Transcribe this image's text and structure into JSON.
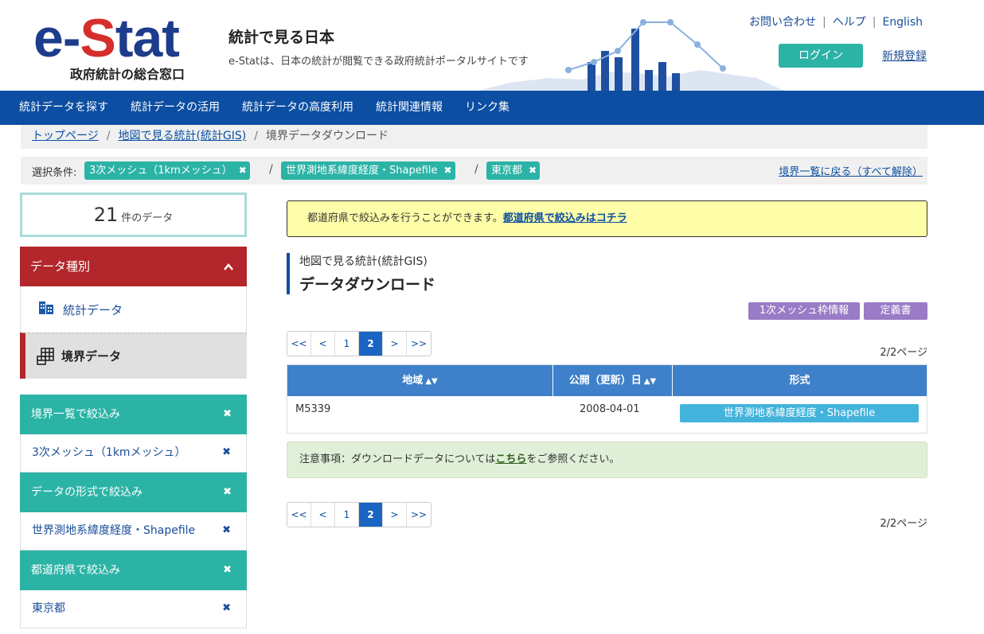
{
  "header": {
    "logo_main": "e-Stat",
    "logo_sub": "政府統計の総合窓口",
    "site_title": "統計で見る日本",
    "site_desc": "e-Statは、日本の統計が閲覧できる政府統計ポータルサイトです",
    "links": [
      "お問い合わせ",
      "ヘルプ",
      "English"
    ],
    "login_label": "ログイン",
    "register_label": "新規登録"
  },
  "nav": {
    "items": [
      "統計データを探す",
      "統計データの活用",
      "統計データの高度利用",
      "統計関連情報",
      "リンク集"
    ]
  },
  "breadcrumb": {
    "items": [
      "トップページ",
      "地図で見る統計(統計GIS)",
      "境界データダウンロード"
    ]
  },
  "conditions": {
    "label": "選択条件:",
    "chips": [
      "3次メッシュ（1kmメッシュ）",
      "世界測地系緯度経度・Shapefile",
      "東京都"
    ],
    "back_link": "境界一覧に戻る（すべて解除）"
  },
  "sidebar": {
    "count": "21",
    "count_unit": "件のデータ",
    "type_header": "データ種別",
    "types": [
      "統計データ",
      "境界データ"
    ],
    "filters": [
      {
        "header": "境界一覧で絞込み",
        "value": "3次メッシュ（1kmメッシュ）"
      },
      {
        "header": "データの形式で絞込み",
        "value": "世界測地系緯度経度・Shapefile"
      },
      {
        "header": "都道府県で絞込み",
        "value": "東京都"
      }
    ],
    "close_symbol": "✖"
  },
  "main": {
    "notice_text": "都道府県で絞込みを行うことができます。",
    "notice_link": "都道府県で絞込みはコチラ",
    "section_sup": "地図で見る統計(統計GIS)",
    "section_title": "データダウンロード",
    "tags": [
      "1次メッシュ枠情報",
      "定義書"
    ],
    "pager": [
      "<<",
      "<",
      "1",
      "2",
      ">",
      ">>"
    ],
    "pager_active": "2",
    "page_info": "2/2ページ",
    "table": {
      "headers": [
        "地域",
        "公開（更新）日",
        "形式"
      ],
      "rows": [
        {
          "region": "M5339",
          "date": "2008-04-01",
          "format": "世界測地系緯度経度・Shapefile"
        }
      ]
    },
    "caution_prefix": "注意事項：ダウンロードデータについては",
    "caution_link": "こちら",
    "caution_suffix": "をご参照ください。"
  },
  "colors": {
    "nav_blue": "#0b4ea2",
    "teal": "#2bb3a6",
    "red": "#b3262b",
    "purple": "#9a7bc6",
    "table_blue": "#3e80c9",
    "notice_yellow": "#fffea8",
    "caution_green": "#e0efd8"
  },
  "icons": [
    "building-icon",
    "grid-icon",
    "close-icon",
    "sort-icon",
    "chevron-up-icon"
  ]
}
